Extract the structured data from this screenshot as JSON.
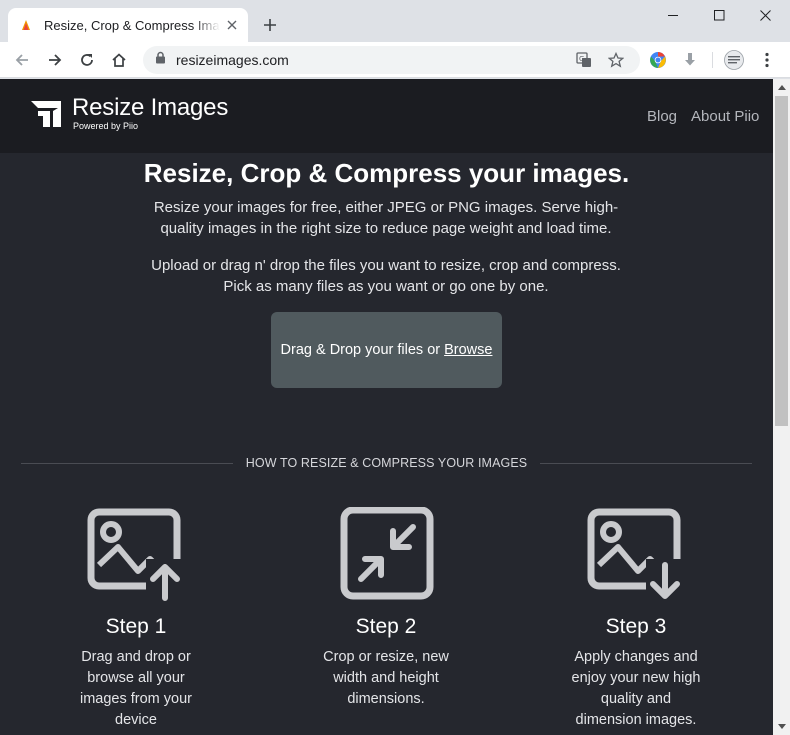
{
  "browser": {
    "tab_title": "Resize, Crop & Compress Images",
    "url": "resizeimages.com"
  },
  "header": {
    "brand_name": "Resize Images",
    "brand_sub": "Powered by Piio",
    "nav": [
      "Blog",
      "About Piio"
    ]
  },
  "hero": {
    "title": "Resize, Crop & Compress your images.",
    "paragraph1": "Resize your images for free, either JPEG or PNG images. Serve high-quality images in the right size to reduce page weight and load time.",
    "paragraph2": "Upload or drag n' drop the files you want to resize, crop and compress. Pick as many files as you want or go one by one."
  },
  "dropzone": {
    "text": "Drag & Drop your files or",
    "browse": "Browse"
  },
  "howto": {
    "heading": "HOW TO RESIZE & COMPRESS YOUR IMAGES",
    "steps": [
      {
        "title": "Step 1",
        "text": "Drag and drop or browse all your images from your device",
        "icon": "image-upload-icon"
      },
      {
        "title": "Step 2",
        "text": "Crop or resize, new width and height dimensions.",
        "icon": "compress-arrows-icon"
      },
      {
        "title": "Step 3",
        "text": "Apply changes and enjoy your new high quality and dimension images.",
        "icon": "image-download-icon"
      }
    ]
  },
  "colors": {
    "page_bg": "#25272e",
    "header_bg": "#1b1c21",
    "dropzone_bg": "#505a5e",
    "icon_stroke": "#c9cacd"
  }
}
